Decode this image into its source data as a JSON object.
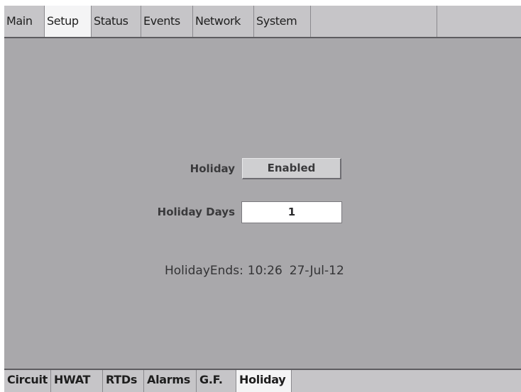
{
  "top_tabs": {
    "items": [
      {
        "label": "Main"
      },
      {
        "label": "Setup"
      },
      {
        "label": "Status"
      },
      {
        "label": "Events"
      },
      {
        "label": "Network"
      },
      {
        "label": "System"
      }
    ],
    "active": "Setup"
  },
  "main": {
    "holiday_label": "Holiday",
    "holiday_button": "Enabled",
    "holiday_days_label": "Holiday Days",
    "holiday_days_value": "1",
    "holiday_ends_label": "HolidayEnds:",
    "holiday_ends_time": "10:26",
    "holiday_ends_date": "27-Jul-12"
  },
  "bottom_tabs": {
    "items": [
      {
        "label": "Circuit"
      },
      {
        "label": "HWAT"
      },
      {
        "label": "RTDs"
      },
      {
        "label": "Alarms"
      },
      {
        "label": "G.F."
      },
      {
        "label": "Holiday"
      }
    ],
    "active": "Holiday"
  },
  "colors": {
    "background": "#a9a8ab",
    "tab_bar": "#c6c5c8",
    "active_tab": "#f4f4f5"
  }
}
